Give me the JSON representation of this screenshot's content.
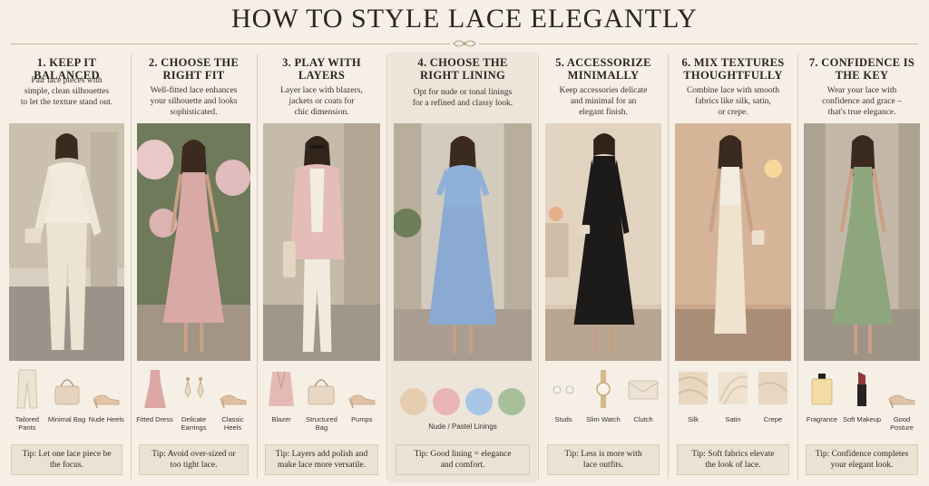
{
  "title": "HOW TO STYLE LACE ELEGANTLY",
  "colors": {
    "background": "#f5efe6",
    "ivory": "#efe6d6",
    "blush": "#d9a9a6",
    "pink_blazer": "#e2b9b5",
    "blue": "#8fb0d8",
    "black": "#1d1a1a",
    "champagne": "#efe2cf",
    "sage": "#8ea67e"
  },
  "sections": [
    {
      "heading": "1. KEEP IT BALANCED",
      "desc": "Pair lace pieces with\nsimple, clean silhouettes\nto let the texture stand out.",
      "accessories": [
        {
          "label": "Tailored Pants",
          "icon": "pants-icon"
        },
        {
          "label": "Minimal Bag",
          "icon": "handbag-icon"
        },
        {
          "label": "Nude Heels",
          "icon": "heel-icon"
        }
      ],
      "tip": "Tip: Let one lace piece be\nthe focus."
    },
    {
      "heading": "2. CHOOSE THE\nRIGHT FIT",
      "desc": "Well-fitted lace enhances\nyour silhouette and looks\nsophisticated.",
      "accessories": [
        {
          "label": "Fitted Dress",
          "icon": "dress-icon"
        },
        {
          "label": "Delicate Earrings",
          "icon": "earrings-icon"
        },
        {
          "label": "Classic Heels",
          "icon": "heel-icon"
        }
      ],
      "tip": "Tip: Avoid over-sized or\ntoo tight lace."
    },
    {
      "heading": "3. PLAY WITH\nLAYERS",
      "desc": "Layer lace with blazers,\njackets or coats for\nchic dimension.",
      "accessories": [
        {
          "label": "Blazer",
          "icon": "blazer-icon"
        },
        {
          "label": "Structured Bag",
          "icon": "handbag-icon"
        },
        {
          "label": "Pumps",
          "icon": "heel-icon"
        }
      ],
      "tip": "Tip: Layers add polish and\nmake lace more versatile."
    },
    {
      "heading": "4. CHOOSE THE\nRIGHT LINING",
      "desc": "Opt for nude or tonal linings\nfor a refined and classy look.",
      "swatch_label": "Nude / Pastel Linings",
      "swatches": [
        "#e6cdb0",
        "#e8b4b4",
        "#a9c6e6",
        "#a8bf9c"
      ],
      "tip": "Tip: Good lining = elegance\nand comfort."
    },
    {
      "heading": "5. ACCESSORIZE\nMINIMALLY",
      "desc": "Keep accessories delicate\nand minimal for an\nelegant finish.",
      "accessories": [
        {
          "label": "Studs",
          "icon": "studs-icon"
        },
        {
          "label": "Slim Watch",
          "icon": "watch-icon"
        },
        {
          "label": "Clutch",
          "icon": "clutch-icon"
        }
      ],
      "tip": "Tip: Less is more with\nlace outfits."
    },
    {
      "heading": "6. MIX TEXTURES\nTHOUGHTFULLY",
      "desc": "Combine lace with smooth\nfabrics like silk, satin,\nor crepe.",
      "accessories": [
        {
          "label": "Silk",
          "icon": "silk-fabric-icon"
        },
        {
          "label": "Satin",
          "icon": "satin-fabric-icon"
        },
        {
          "label": "Crepe",
          "icon": "crepe-fabric-icon"
        }
      ],
      "tip": "Tip: Soft fabrics elevate\nthe look of lace."
    },
    {
      "heading": "7. CONFIDENCE IS\nTHE KEY",
      "desc": "Wear your lace with\nconfidence and grace –\nthat's true elegance.",
      "accessories": [
        {
          "label": "Fragrance",
          "icon": "perfume-icon"
        },
        {
          "label": "Soft Makeup",
          "icon": "lipstick-icon"
        },
        {
          "label": "Good Posture",
          "icon": "heel-icon"
        }
      ],
      "tip": "Tip: Confidence completes\nyour elegant look."
    }
  ]
}
